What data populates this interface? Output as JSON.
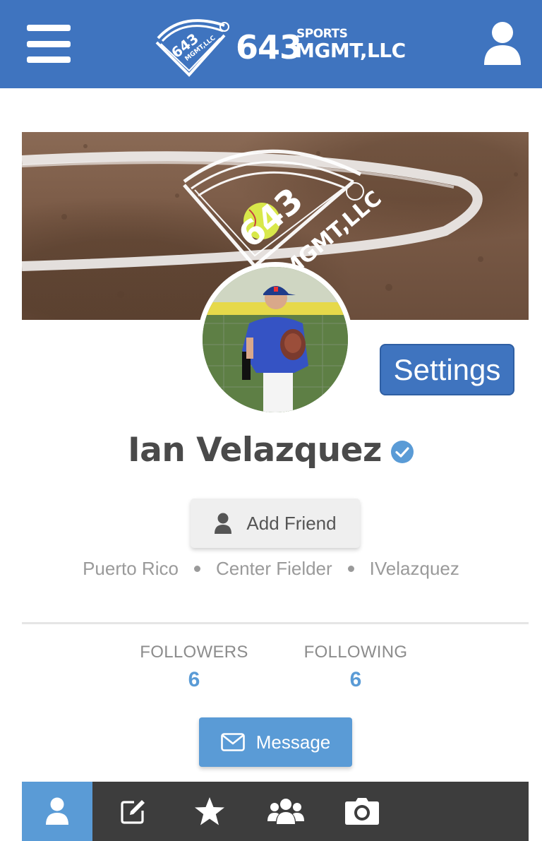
{
  "header": {
    "menu_icon": "hamburger-menu-icon",
    "brand": {
      "number": "643",
      "sports": "SPORTS",
      "mgmt": "MGMT,LLC",
      "emblem_text": "643 SPORTS MGMT,LLC"
    },
    "user_icon": "user-icon",
    "color": "#3f74bf"
  },
  "profile": {
    "cover_watermark": "643 SPORTS MGMT,LLC",
    "name": "Ian Velazquez",
    "verified_icon": "verified-check-icon",
    "settings_label": "Settings",
    "add_friend_label": "Add Friend",
    "meta": [
      "Puerto Rico",
      "Center Fielder",
      "IVelazquez"
    ]
  },
  "stats": {
    "followers": {
      "label": "FOLLOWERS",
      "value": "6"
    },
    "following": {
      "label": "FOLLOWING",
      "value": "6"
    }
  },
  "message_label": "Message",
  "tabs": [
    {
      "icon": "profile-icon",
      "active": true
    },
    {
      "icon": "edit-icon",
      "active": false
    },
    {
      "icon": "star-icon",
      "active": false
    },
    {
      "icon": "group-icon",
      "active": false
    },
    {
      "icon": "camera-icon",
      "active": false
    }
  ],
  "colors": {
    "accent": "#5a9bd6",
    "brand_blue": "#3f74bf",
    "tabbar": "#3d3d3d"
  }
}
